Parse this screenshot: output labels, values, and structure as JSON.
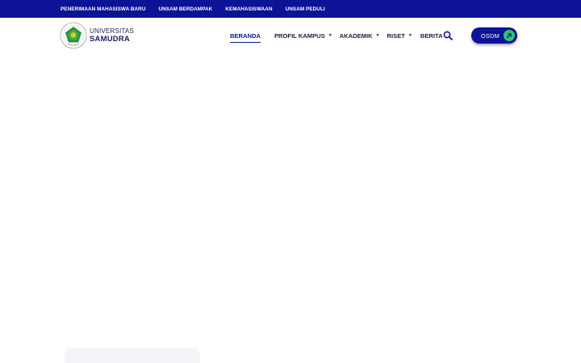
{
  "topbar": {
    "bg_color": "#0c1396",
    "links": [
      {
        "label": "PENERIMAAN MAHASISWA BARU"
      },
      {
        "label": "UNSAM BERDAMPAK"
      },
      {
        "label": "KEMAHASISWAAN"
      },
      {
        "label": "UNSAM PEDULI"
      }
    ]
  },
  "logo": {
    "line1": "UNIVERSITAS",
    "line2": "SAMUDRA",
    "emblem_icon": "university-emblem-icon"
  },
  "nav": {
    "items": [
      {
        "label": "BERANDA",
        "active": true,
        "dropdown": false
      },
      {
        "label": "PROFIL KAMPUS",
        "active": false,
        "dropdown": true
      },
      {
        "label": "AKADEMIK",
        "active": false,
        "dropdown": true
      },
      {
        "label": "RISET",
        "active": false,
        "dropdown": true
      },
      {
        "label": "BERITA",
        "active": false,
        "dropdown": false
      }
    ],
    "search_icon": "search-icon"
  },
  "osdm_button": {
    "label": "OSDM",
    "color": "#0c1396",
    "arrow_color": "#32c56a",
    "arrow_icon": "arrow-up-right-icon"
  }
}
